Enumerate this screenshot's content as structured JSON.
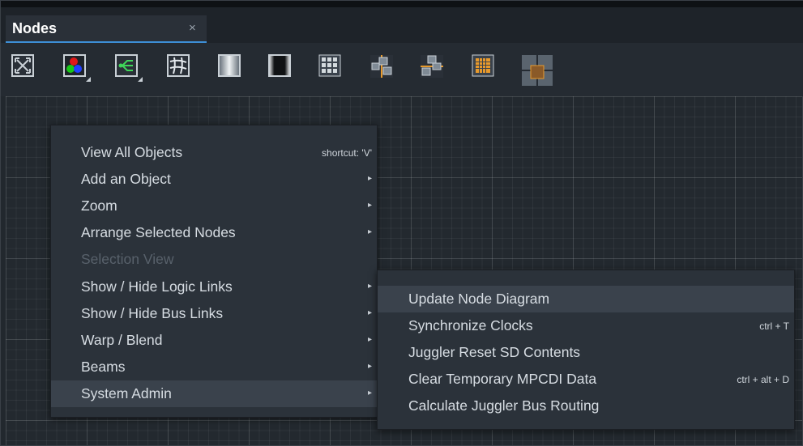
{
  "colors": {
    "accent": "#3d8fd6",
    "panel": "#2b323a",
    "highlight": "#3a424c",
    "disabled_text": "#58616b"
  },
  "tab": {
    "title": "Nodes",
    "close": "×"
  },
  "toolbar": {
    "icons": [
      "fit-view-icon",
      "rgb-color-icon",
      "tree-links-icon",
      "warp-grid-icon",
      "blend-gradient-icon",
      "dark-gradient-icon",
      "grid-layout-icon",
      "node-align-icon",
      "bus-routing-icon",
      "dot-matrix-icon",
      "tile-layout-icon"
    ]
  },
  "context_menu": {
    "items": [
      {
        "label": "View All Objects",
        "shortcut": "shortcut: 'V'"
      },
      {
        "label": "Add an Object",
        "submenu": "▸"
      },
      {
        "label": "Zoom",
        "submenu": "▸"
      },
      {
        "label": "Arrange Selected Nodes",
        "submenu": "▸"
      },
      {
        "label": "Selection View",
        "disabled": true
      },
      {
        "label": "Show / Hide Logic Links",
        "submenu": "▸"
      },
      {
        "label": "Show / Hide Bus Links",
        "submenu": "▸"
      },
      {
        "label": "Warp / Blend",
        "submenu": "▸"
      },
      {
        "label": "Beams",
        "submenu": "▸"
      },
      {
        "label": "System Admin",
        "submenu": "▸",
        "active": true
      }
    ]
  },
  "submenu": {
    "items": [
      {
        "label": "Update Node Diagram",
        "active": true
      },
      {
        "label": "Synchronize Clocks",
        "shortcut": "ctrl + T"
      },
      {
        "label": "Juggler Reset SD Contents"
      },
      {
        "label": "Clear Temporary MPCDI Data",
        "shortcut": "ctrl + alt + D"
      },
      {
        "label": "Calculate Juggler Bus Routing"
      }
    ]
  }
}
